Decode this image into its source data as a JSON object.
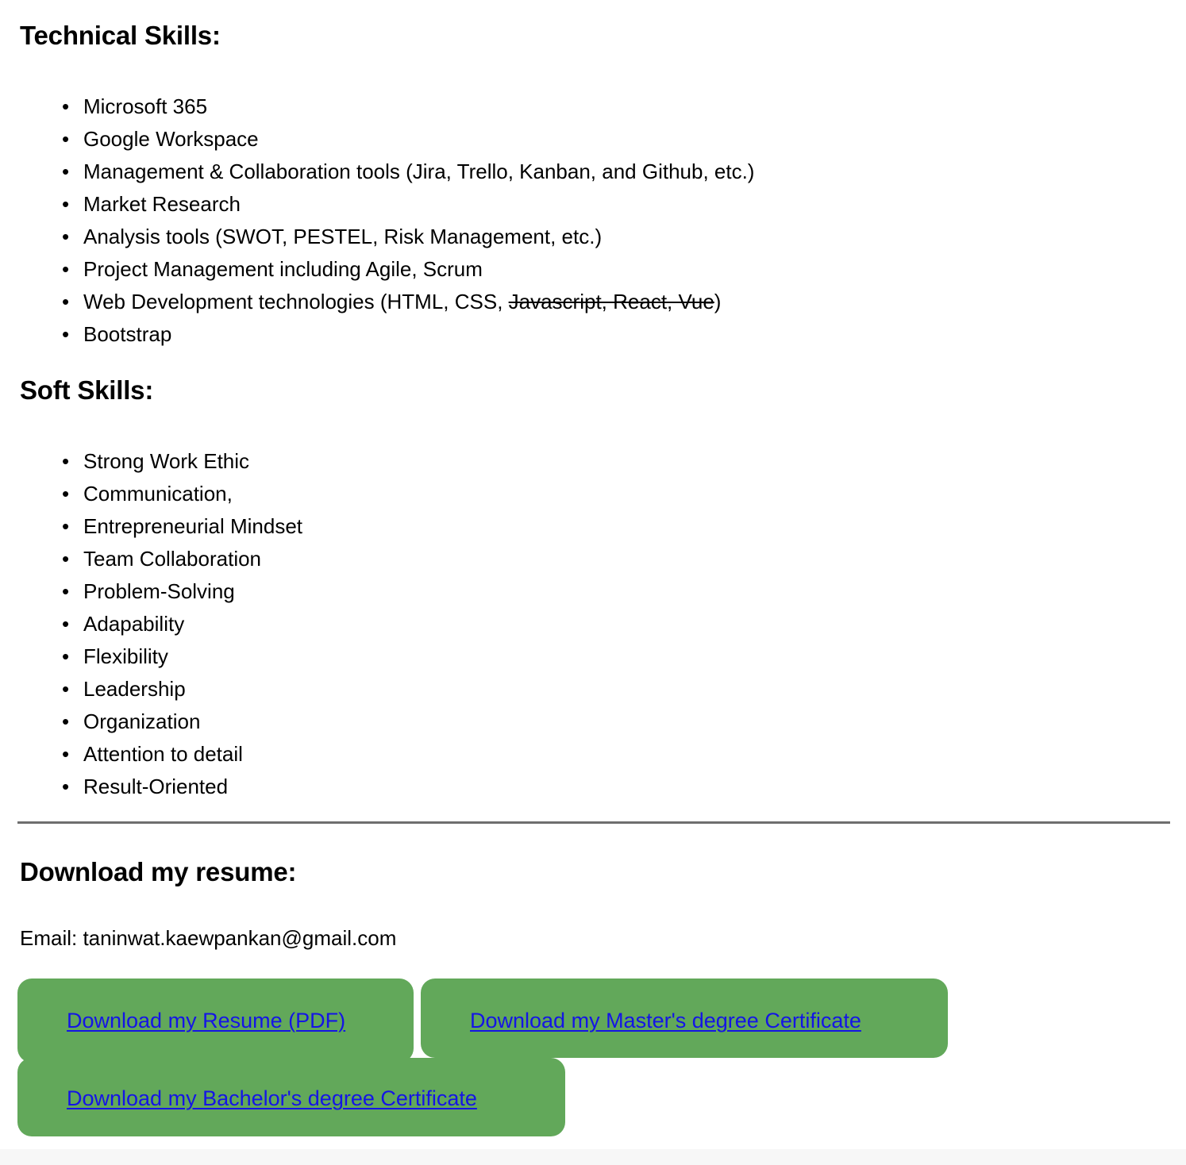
{
  "technical": {
    "heading": "Technical Skills:",
    "items": [
      {
        "text": "Microsoft 365"
      },
      {
        "text": "Google Workspace"
      },
      {
        "text": "Management & Collaboration tools (Jira, Trello, Kanban, and Github, etc.)"
      },
      {
        "text": "Market Research"
      },
      {
        "text": "Analysis tools (SWOT, PESTEL, Risk Management, etc.)"
      },
      {
        "text": "Project Management including Agile, Scrum"
      },
      {
        "text": "Web Development technologies (HTML, CSS, Javascript, React, Vue)",
        "prefix": "Web Development technologies (HTML, CSS, ",
        "struck": "Javascript, React, Vue",
        "suffix": ")"
      },
      {
        "text": "Bootstrap"
      }
    ]
  },
  "soft": {
    "heading": "Soft Skills:",
    "items": [
      {
        "text": "Strong Work Ethic"
      },
      {
        "text": "Communication,"
      },
      {
        "text": "Entrepreneurial Mindset"
      },
      {
        "text": "Team Collaboration"
      },
      {
        "text": "Problem-Solving"
      },
      {
        "text": "Adapability"
      },
      {
        "text": "Flexibility"
      },
      {
        "text": "Leadership"
      },
      {
        "text": "Organization"
      },
      {
        "text": "Attention to detail"
      },
      {
        "text": "Result-Oriented"
      }
    ]
  },
  "download": {
    "heading": "Download my resume:",
    "email_label": "Email: taninwat.kaewpankan@gmail.com",
    "buttons": [
      {
        "label": "Download my Resume (PDF)"
      },
      {
        "label": "Download my Master's degree Certificate"
      },
      {
        "label": "Download my Bachelor's degree Certificate"
      }
    ]
  },
  "colors": {
    "button_green": "#62a85a",
    "link_blue": "#1414e6",
    "divider_gray": "#6e6e6e",
    "text_black": "#000000",
    "page_background": "#ffffff"
  }
}
